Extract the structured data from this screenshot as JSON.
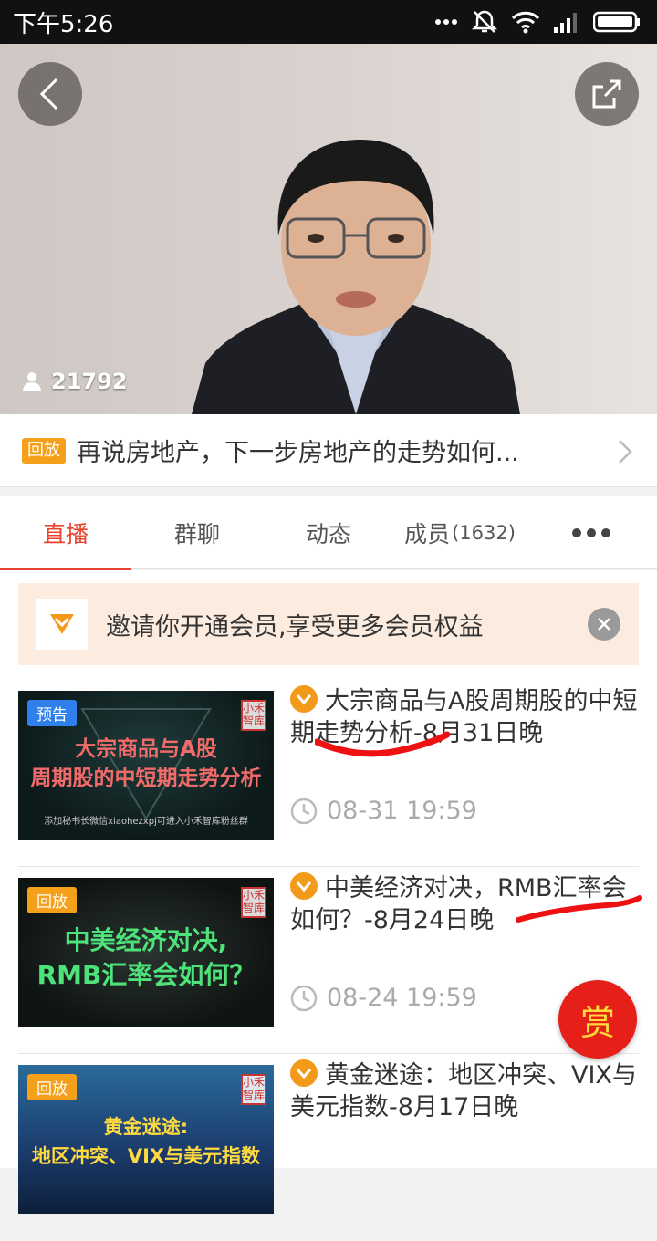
{
  "status_bar": {
    "time": "下午5:26"
  },
  "video": {
    "viewer_count": "21792"
  },
  "title_bar": {
    "tag": "回放",
    "title": "再说房地产，下一步房地产的走势如何..."
  },
  "tabs": [
    {
      "label": "直播",
      "count": ""
    },
    {
      "label": "群聊",
      "count": ""
    },
    {
      "label": "动态",
      "count": ""
    },
    {
      "label": "成员",
      "count": "(1632)"
    }
  ],
  "banner": {
    "text": "邀请你开通会员,享受更多会员权益"
  },
  "items": [
    {
      "badge": "预告",
      "badge_color": "#2f80ed",
      "thumb_title": "大宗商品与A股\n周期股的中短期走势分析",
      "thumb_sub": "添加秘书长微信xiaohezxpj可进入小禾智库粉丝群",
      "seal": "小禾\n智库",
      "title": "大宗商品与A股周期股的中短期走势分析-8月31日晚",
      "time": "08-31 19:59"
    },
    {
      "badge": "回放",
      "badge_color": "#f5a01a",
      "thumb_title": "中美经济对决,\nRMB汇率会如何？",
      "thumb_sub": "",
      "seal": "小禾\n智库",
      "title": "中美经济对决，RMB汇率会如何？-8月24日晚",
      "time": "08-24 19:59"
    },
    {
      "badge": "回放",
      "badge_color": "#f5a01a",
      "thumb_title": "黄金迷途:\n地区冲突、VIX与美元指数",
      "thumb_sub": "",
      "seal": "小禾\n智库",
      "title": "黄金迷途：地区冲突、VIX与美元指数-8月17日晚",
      "time": ""
    }
  ],
  "reward_button": {
    "label": "赏"
  },
  "colors": {
    "accent": "#e8432f",
    "orange": "#f5a01a",
    "banner_bg": "#fcebdf"
  }
}
